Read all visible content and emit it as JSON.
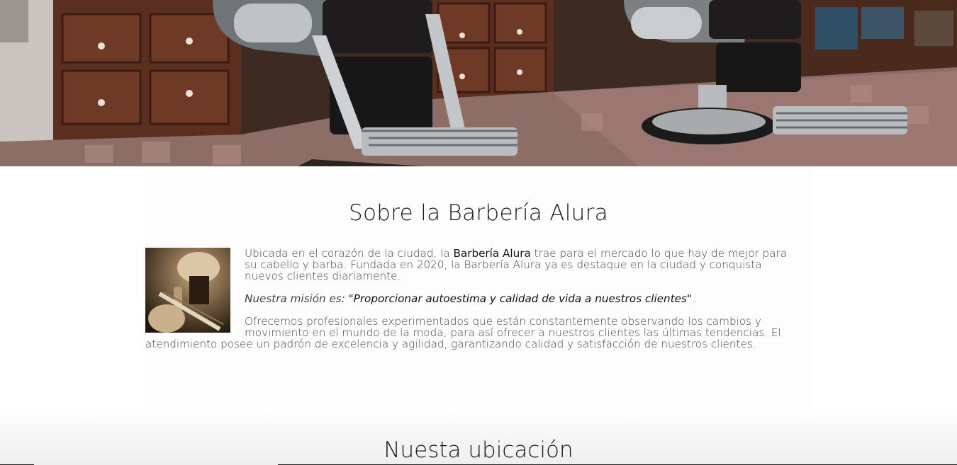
{
  "hero": {
    "image": "barbershop-chairs-photo"
  },
  "about": {
    "title": "Sobre la Barbería Alura",
    "image": "shaving-brush-razor-photo",
    "p1_a": "Ubicada en el corazón de la ciudad, la ",
    "p1_brand": "Barbería Alura",
    "p1_b": " trae para el mercado lo que hay de mejor para su cabello y barba. Fundada en 2020, la Barbería Alura ya es destaque en la ciudad y conquista nuevos clientes diariamente.",
    "mission_label": "Nuestra misión es: ",
    "mission_quote": "\"Proporcionar autoestima y calidad de vida a nuestros clientes\"",
    "mission_end": ".",
    "p3": "Ofrecemos profesionales experimentados que están constantemente observando los cambios y movimiento en el mundo de la moda, para así ofrecer a nuestros clientes las últimas tendencias. El atendimiento posee un padrón de excelencia y agilidad, garantizando calidad y satisfacción de nuestros clientes."
  },
  "location": {
    "title": "Nuesta ubicación"
  }
}
